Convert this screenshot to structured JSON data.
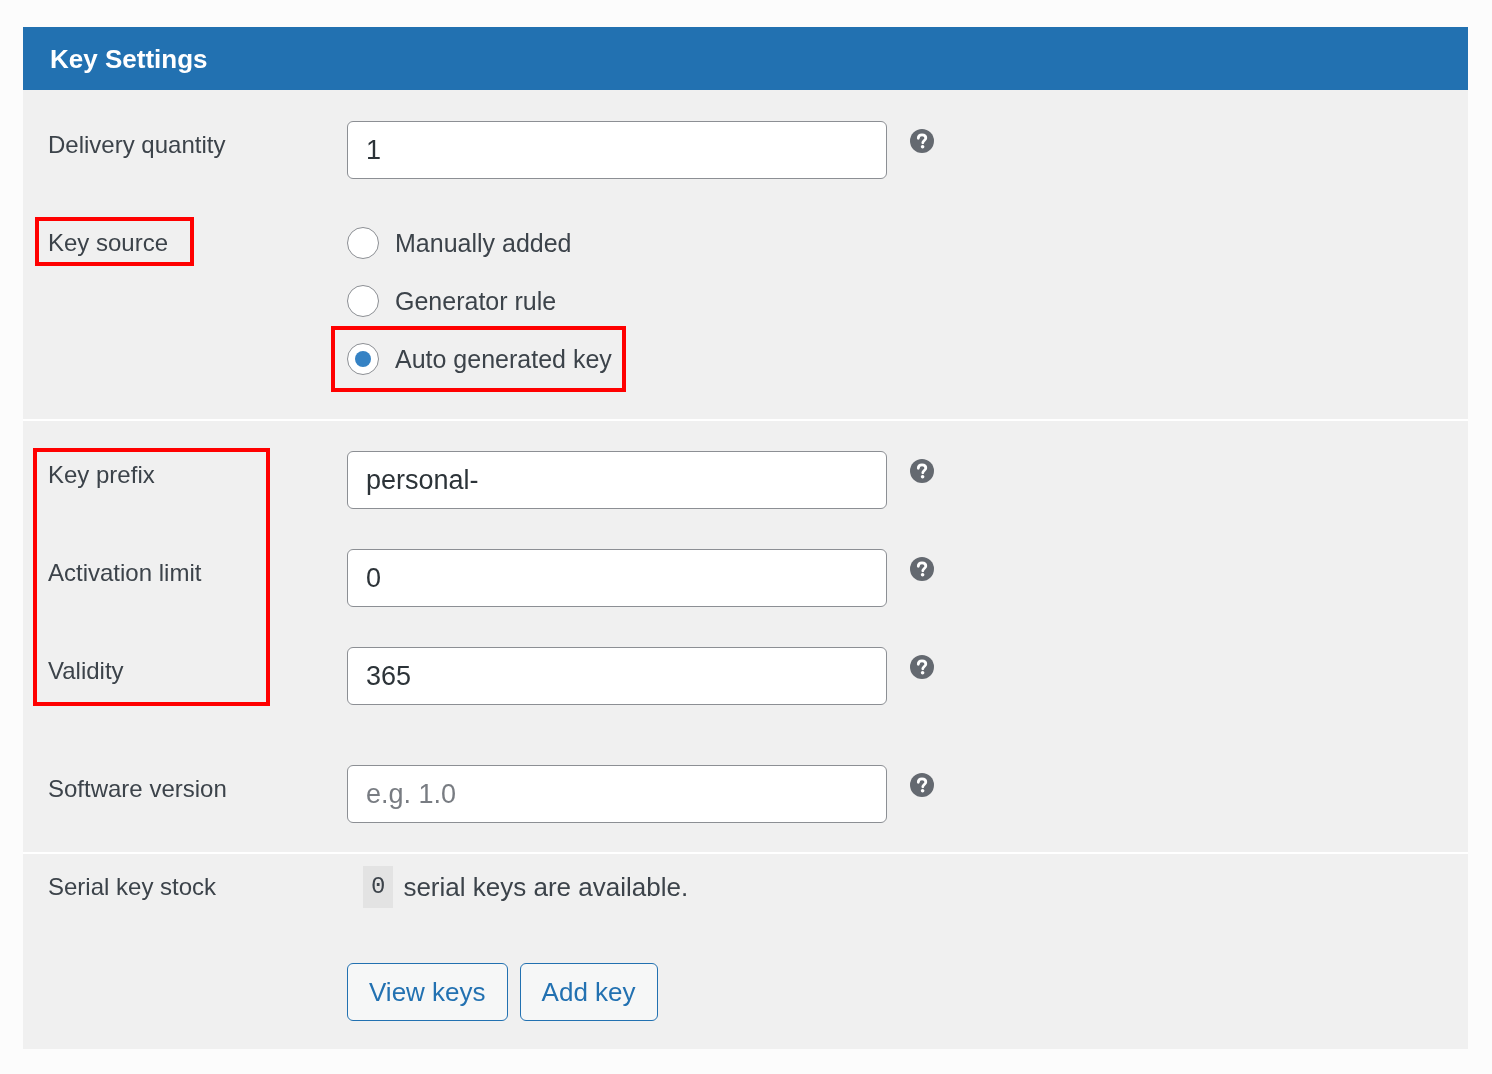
{
  "panel": {
    "title": "Key Settings"
  },
  "sections": [
    {
      "groups": [
        {
          "highlighted": false,
          "rows": [
            {
              "kind": "text",
              "label": "Delivery quantity",
              "value": "1",
              "help": true
            }
          ]
        },
        {
          "highlighted": true,
          "rows": [
            {
              "kind": "radio",
              "label": "Key source",
              "options": [
                {
                  "label": "Manually added",
                  "selected": false,
                  "highlighted": false
                },
                {
                  "label": "Generator rule",
                  "selected": false,
                  "highlighted": false
                },
                {
                  "label": "Auto generated key",
                  "selected": true,
                  "highlighted": true
                }
              ]
            }
          ]
        }
      ]
    },
    {
      "groups": [
        {
          "highlighted": true,
          "rows": [
            {
              "kind": "text",
              "label": "Key prefix",
              "value": "personal-",
              "help": true
            },
            {
              "kind": "text",
              "label": "Activation limit",
              "value": "0",
              "help": true
            },
            {
              "kind": "text",
              "label": "Validity",
              "value": "365",
              "help": true
            }
          ]
        },
        {
          "highlighted": false,
          "rows": [
            {
              "kind": "text",
              "label": "Software version",
              "placeholder": "e.g. 1.0",
              "help": true
            }
          ]
        }
      ]
    },
    {
      "groups": [
        {
          "highlighted": false,
          "rows": [
            {
              "kind": "stock",
              "label": "Serial key stock",
              "count": "0",
              "text": "serial keys are available."
            }
          ]
        },
        {
          "highlighted": false,
          "rows": [
            {
              "kind": "buttons",
              "buttons": [
                {
                  "label": "View keys"
                },
                {
                  "label": "Add key"
                }
              ]
            }
          ]
        }
      ]
    }
  ]
}
